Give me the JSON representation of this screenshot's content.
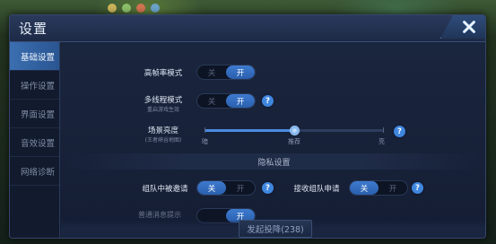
{
  "panel": {
    "title": "设置",
    "close_icon": "close-x-icon"
  },
  "sidebar": {
    "items": [
      {
        "label": "基础设置",
        "active": true
      },
      {
        "label": "操作设置",
        "active": false
      },
      {
        "label": "界面设置",
        "active": false
      },
      {
        "label": "音效设置",
        "active": false
      },
      {
        "label": "网络诊断",
        "active": false
      }
    ]
  },
  "settings": {
    "high_fps": {
      "label": "高帧率模式",
      "off": "关",
      "on": "开",
      "value": "开"
    },
    "multithread": {
      "label": "多线程模式",
      "sublabel": "重启游戏生效",
      "off": "关",
      "on": "开",
      "value": "开"
    },
    "brightness": {
      "label": "场景亮度",
      "sublabel": "(王者峡谷地图)",
      "min_label": "暗",
      "mid_label": "推荐",
      "max_label": "亮",
      "value": 0.5
    }
  },
  "privacy": {
    "section_title": "隐私设置",
    "team_invite": {
      "label": "组队中被邀请",
      "on": "关",
      "off": "开",
      "value": "关"
    },
    "team_request": {
      "label": "接收组队申请",
      "on": "关",
      "off": "开",
      "value": "关"
    },
    "truncated_label": "普通消息提示",
    "truncated_on": "开"
  },
  "footer": {
    "surrender_label": "发起投降(238)"
  },
  "colors": {
    "accent": "#3e7bd0",
    "help": "#3f86de",
    "panel": "#1b2740"
  }
}
